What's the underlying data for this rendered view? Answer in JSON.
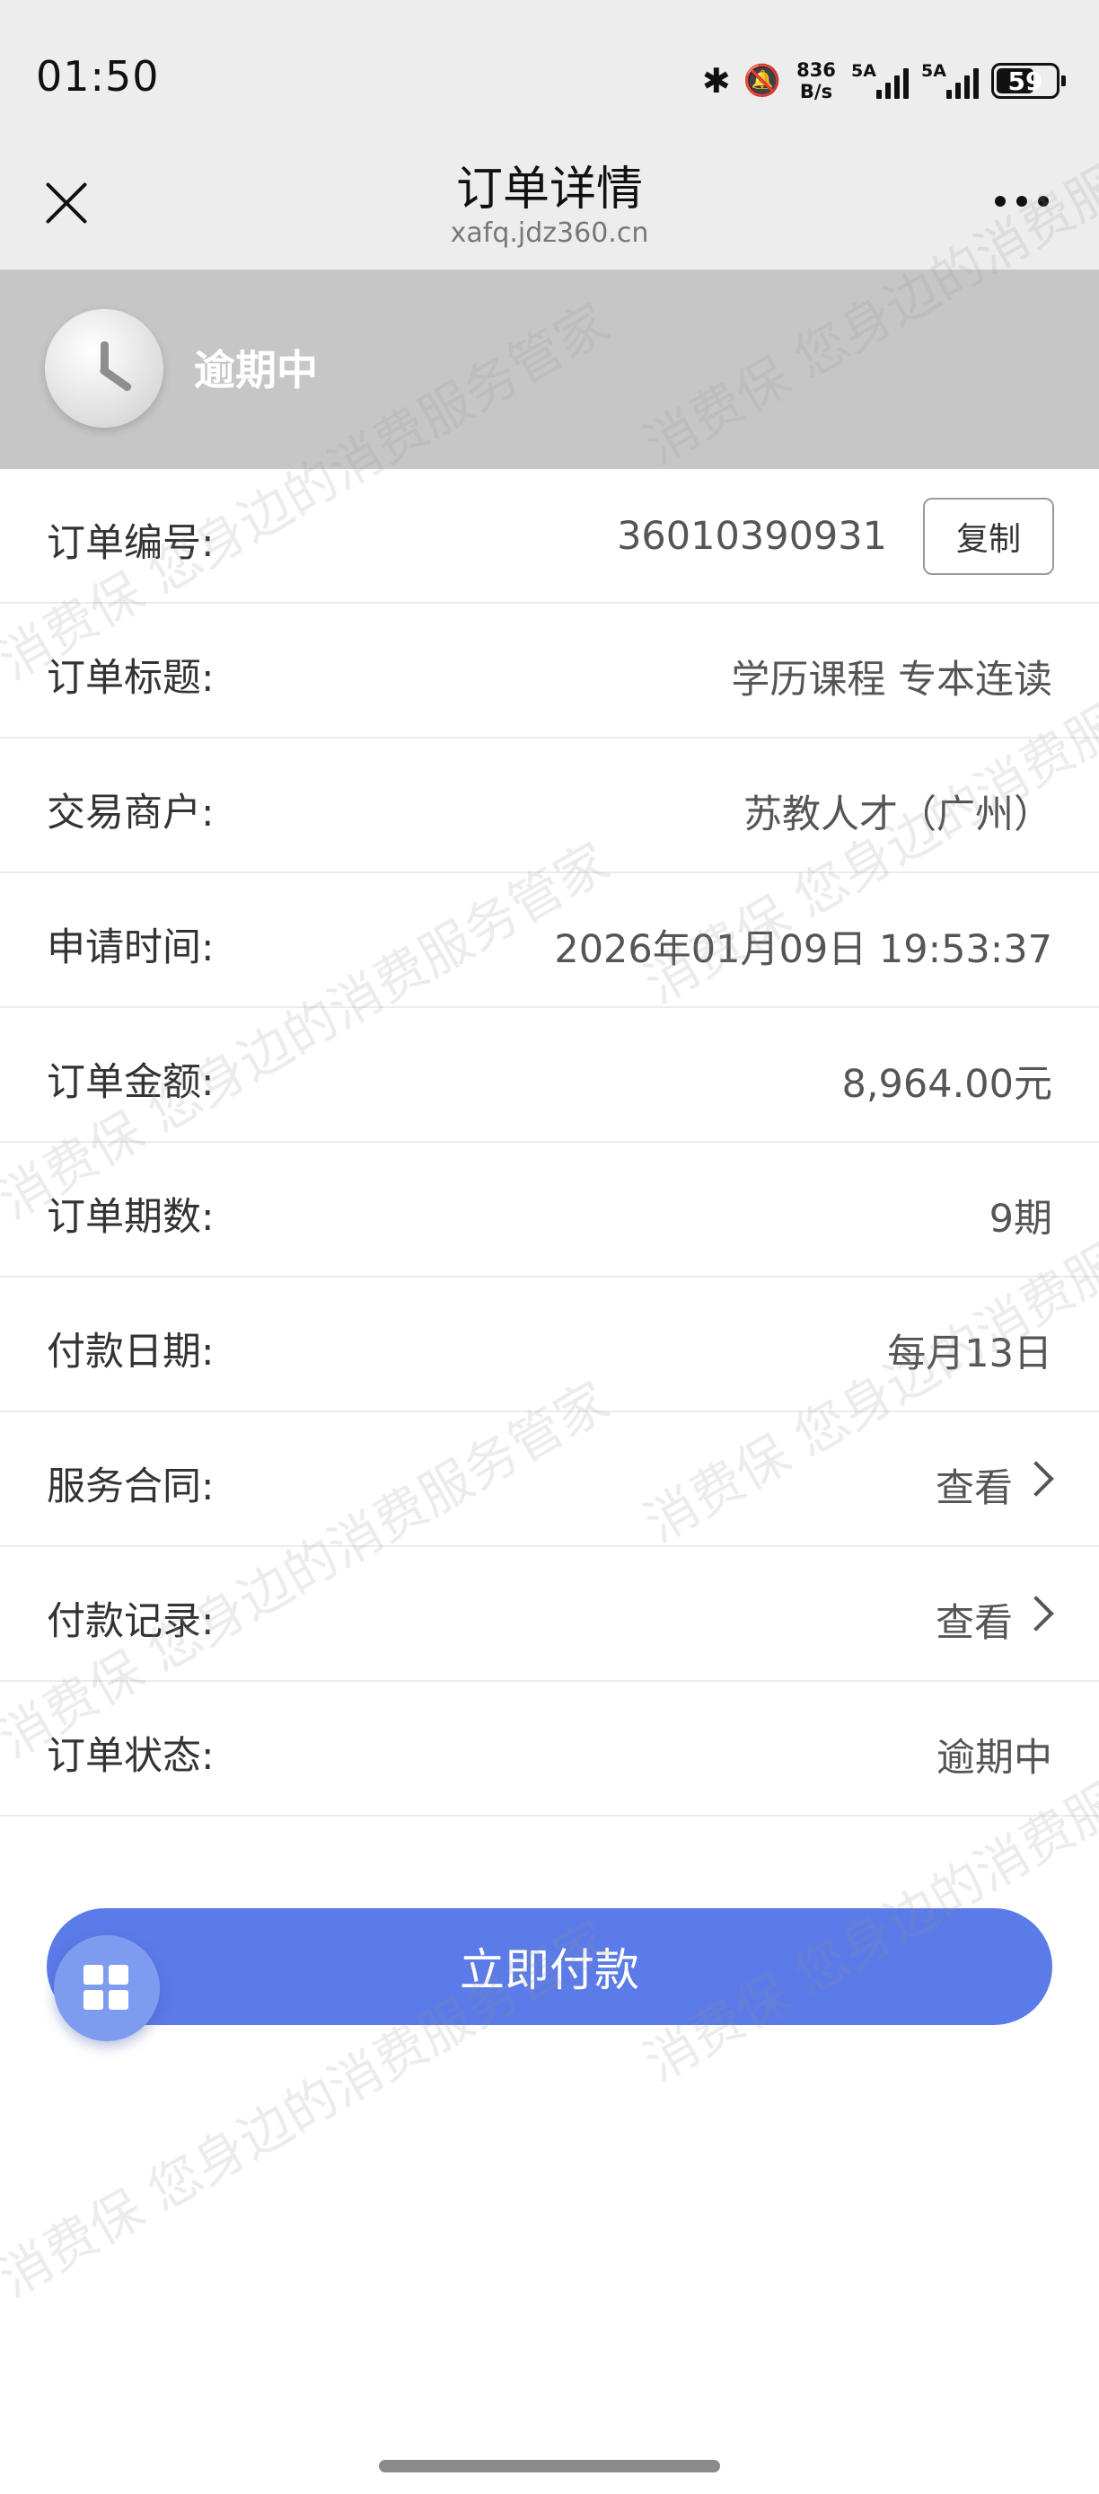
{
  "status_bar": {
    "time": "01:50",
    "speed_top": "836",
    "speed_bottom": "B/s",
    "signal1": "5A",
    "signal2": "5A",
    "battery": "59"
  },
  "nav": {
    "title": "订单详情",
    "url": "xafq.jdz360.cn"
  },
  "banner": {
    "status_text": "逾期中"
  },
  "order": {
    "rows": [
      {
        "label": "订单编号:",
        "value": "36010390931"
      },
      {
        "label": "订单标题:",
        "value": "学历课程 专本连读"
      },
      {
        "label": "交易商户:",
        "value": "苏教人才（广州）"
      },
      {
        "label": "申请时间:",
        "value": "2026年01月09日 19:53:37"
      },
      {
        "label": "订单金额:",
        "value": "8,964.00元"
      },
      {
        "label": "订单期数:",
        "value": "9期"
      },
      {
        "label": "付款日期:",
        "value": "每月13日"
      },
      {
        "label": "服务合同:",
        "value": "查看"
      },
      {
        "label": "付款记录:",
        "value": "查看"
      },
      {
        "label": "订单状态:",
        "value": "逾期中"
      }
    ],
    "copy_label": "复制"
  },
  "pay_button_label": "立即付款",
  "watermark": {
    "line1": "消费保 您身边的消费服务管家"
  },
  "colors": {
    "accent": "#5b7be8",
    "banner_bg": "#c6c6c6",
    "bar_bg": "#ededed"
  },
  "icons": [
    "bluetooth-icon",
    "mute-bell-icon",
    "signal-icon",
    "battery-icon",
    "close-icon",
    "more-icon",
    "clock-icon",
    "chevron-right-icon",
    "grid-icon"
  ]
}
